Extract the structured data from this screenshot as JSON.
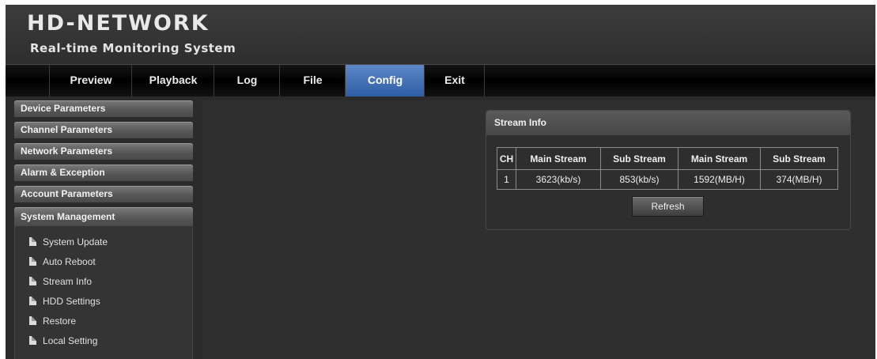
{
  "header": {
    "title": "HD-NETWORK",
    "subtitle": "Real-time Monitoring System"
  },
  "nav": {
    "items": [
      {
        "label": "Preview"
      },
      {
        "label": "Playback"
      },
      {
        "label": "Log"
      },
      {
        "label": "File"
      },
      {
        "label": "Config",
        "active": true
      },
      {
        "label": "Exit"
      }
    ]
  },
  "sidebar": {
    "sections": [
      {
        "label": "Device Parameters"
      },
      {
        "label": "Channel Parameters"
      },
      {
        "label": "Network Parameters"
      },
      {
        "label": "Alarm & Exception"
      },
      {
        "label": "Account Parameters"
      },
      {
        "label": "System Management",
        "expanded": true
      }
    ],
    "submenu": [
      {
        "label": "System Update"
      },
      {
        "label": "Auto Reboot"
      },
      {
        "label": "Stream Info"
      },
      {
        "label": "HDD Settings"
      },
      {
        "label": "Restore"
      },
      {
        "label": "Local Setting"
      }
    ]
  },
  "stream_info": {
    "title": "Stream Info",
    "headers": [
      "CH",
      "Main Stream",
      "Sub Stream",
      "Main Stream",
      "Sub Stream"
    ],
    "rows": [
      [
        "1",
        "3623(kb/s)",
        "853(kb/s)",
        "1592(MB/H)",
        "374(MB/H)"
      ]
    ],
    "refresh_label": "Refresh"
  },
  "colors": {
    "nav_active": "#3a6bb5",
    "background": "#2b2b2b"
  }
}
